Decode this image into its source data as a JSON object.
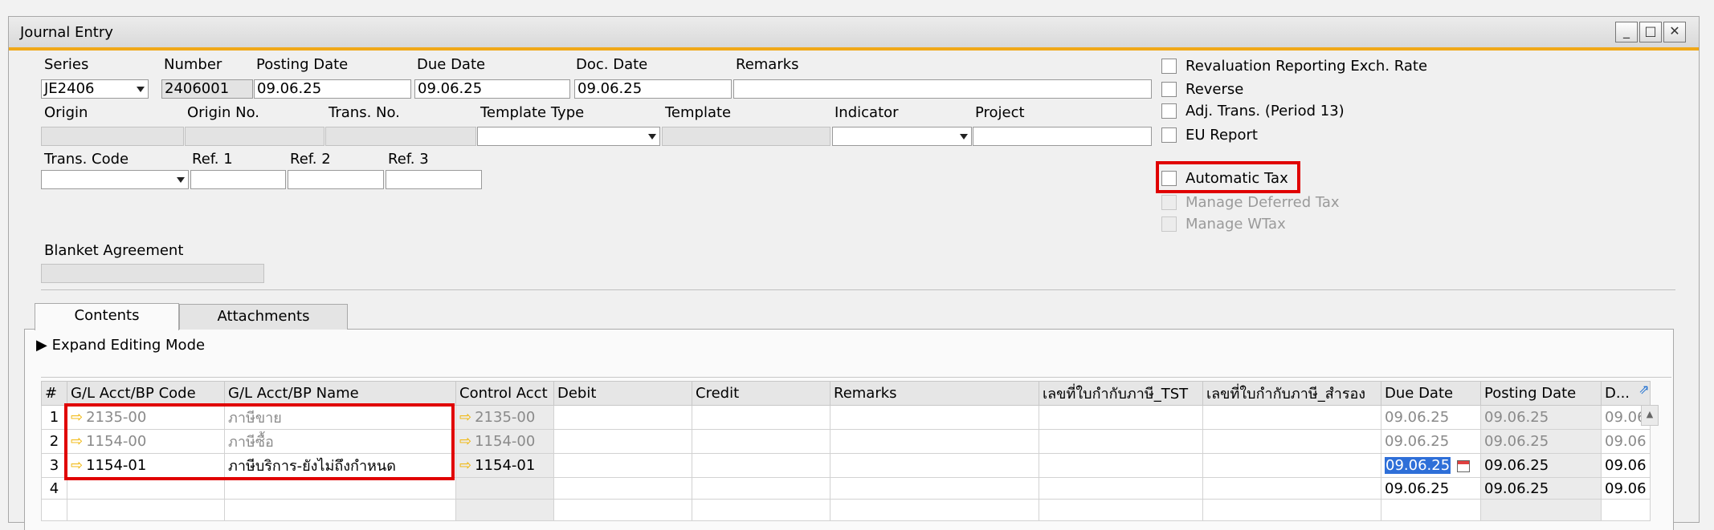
{
  "window": {
    "title": "Journal Entry",
    "buttons": {
      "minimize": "_",
      "maximize": "□",
      "close": "✕"
    }
  },
  "header": {
    "series": {
      "label": "Series",
      "value": "JE2406"
    },
    "number": {
      "label": "Number",
      "value": "2406001"
    },
    "posting_date": {
      "label": "Posting Date",
      "value": "09.06.25"
    },
    "due_date": {
      "label": "Due Date",
      "value": "09.06.25"
    },
    "doc_date": {
      "label": "Doc. Date",
      "value": "09.06.25"
    },
    "remarks": {
      "label": "Remarks",
      "value": ""
    },
    "origin": {
      "label": "Origin",
      "value": ""
    },
    "origin_no": {
      "label": "Origin No.",
      "value": ""
    },
    "trans_no": {
      "label": "Trans. No.",
      "value": ""
    },
    "template_type": {
      "label": "Template Type",
      "value": ""
    },
    "template": {
      "label": "Template",
      "value": ""
    },
    "indicator": {
      "label": "Indicator",
      "value": ""
    },
    "project": {
      "label": "Project",
      "value": ""
    },
    "trans_code": {
      "label": "Trans. Code",
      "value": ""
    },
    "ref1": {
      "label": "Ref. 1",
      "value": ""
    },
    "ref2": {
      "label": "Ref. 2",
      "value": ""
    },
    "ref3": {
      "label": "Ref. 3",
      "value": ""
    },
    "blanket_agreement": {
      "label": "Blanket Agreement",
      "value": ""
    }
  },
  "options": {
    "revaluation": {
      "label": "Revaluation Reporting Exch. Rate",
      "checked": false,
      "enabled": true
    },
    "reverse": {
      "label": "Reverse",
      "checked": false,
      "enabled": true
    },
    "adj_trans": {
      "label": "Adj. Trans. (Period 13)",
      "checked": false,
      "enabled": true
    },
    "eu_report": {
      "label": "EU Report",
      "checked": false,
      "enabled": true
    },
    "automatic_tax": {
      "label": "Automatic Tax",
      "checked": false,
      "enabled": true,
      "highlighted": true
    },
    "manage_deferred_tax": {
      "label": "Manage Deferred Tax",
      "checked": false,
      "enabled": false
    },
    "manage_wtax": {
      "label": "Manage WTax",
      "checked": false,
      "enabled": false
    }
  },
  "tabs": [
    {
      "label": "Contents",
      "active": true
    },
    {
      "label": "Attachments",
      "active": false
    }
  ],
  "expand_editing_mode": "Expand Editing Mode",
  "grid": {
    "columns": [
      "#",
      "G/L Acct/BP Code",
      "G/L Acct/BP Name",
      "Control Acct",
      "Debit",
      "Credit",
      "Remarks",
      "เลขที่ใบกำกับภาษี_TST",
      "เลขที่ใบกำกับภาษี_สำรอง",
      "Due Date",
      "Posting Date",
      "D..."
    ],
    "rows": [
      {
        "num": "1",
        "code": "2135-00",
        "name": "ภาษีขาย",
        "control": "2135-00",
        "debit": "",
        "credit": "",
        "remarks": "",
        "tax_tst": "",
        "tax_reserve": "",
        "due_date": "09.06.25",
        "posting_date": "09.06.25",
        "doc_date": "09.06"
      },
      {
        "num": "2",
        "code": "1154-00",
        "name": "ภาษีซื้อ",
        "control": "1154-00",
        "debit": "",
        "credit": "",
        "remarks": "",
        "tax_tst": "",
        "tax_reserve": "",
        "due_date": "09.06.25",
        "posting_date": "09.06.25",
        "doc_date": "09.06"
      },
      {
        "num": "3",
        "code": "1154-01",
        "name": "ภาษีบริการ-ยังไม่ถึงกำหนด",
        "control": "1154-01",
        "debit": "",
        "credit": "",
        "remarks": "",
        "tax_tst": "",
        "tax_reserve": "",
        "due_date": "09.06.25",
        "posting_date": "09.06.25",
        "doc_date": "09.06"
      },
      {
        "num": "4",
        "code": "",
        "name": "",
        "control": "",
        "debit": "",
        "credit": "",
        "remarks": "",
        "tax_tst": "",
        "tax_reserve": "",
        "due_date": "09.06.25",
        "posting_date": "09.06.25",
        "doc_date": "09.06"
      }
    ]
  },
  "colors": {
    "accent": "#f0a818",
    "highlight_box": "#e00000",
    "selection": "#2e6fd8",
    "row_arrow": "#f0b400"
  }
}
